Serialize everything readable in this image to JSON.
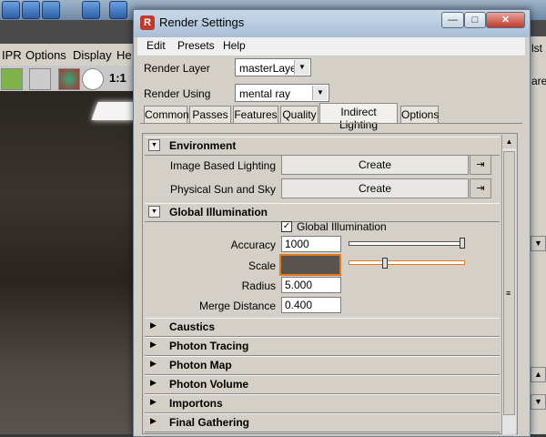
{
  "background_app": {
    "menus": [
      "IPR",
      "Options",
      "Display",
      "He"
    ],
    "toolbar_ratio": "1:1",
    "right_panel_texts": [
      "lst",
      "are"
    ]
  },
  "dialog": {
    "title": "Render Settings",
    "app_icon_glyph": "R",
    "window_buttons": {
      "minimize": "—",
      "maximize": "□",
      "close": "✕"
    },
    "menu": [
      "Edit",
      "Presets",
      "Help"
    ],
    "render_layer": {
      "label": "Render Layer",
      "value": "masterLayer"
    },
    "render_using": {
      "label": "Render Using",
      "value": "mental ray"
    },
    "tabs": [
      "Common",
      "Passes",
      "Features",
      "Quality",
      "Indirect Lighting",
      "Options"
    ],
    "active_tab": "Indirect Lighting",
    "environment": {
      "title": "Environment",
      "rows": [
        {
          "label": "Image Based Lighting",
          "button": "Create"
        },
        {
          "label": "Physical Sun and Sky",
          "button": "Create"
        }
      ]
    },
    "global_illumination": {
      "title": "Global Illumination",
      "checkbox_label": "Global Illumination",
      "checked": true,
      "accuracy": {
        "label": "Accuracy",
        "value": "1000",
        "slider_fraction": 1.0
      },
      "scale": {
        "label": "Scale",
        "color": "#5a5450",
        "slider_fraction": 0.3
      },
      "radius": {
        "label": "Radius",
        "value": "5.000"
      },
      "merge_distance": {
        "label": "Merge Distance",
        "value": "0.400"
      }
    },
    "collapsed_sections": [
      "Caustics",
      "Photon Tracing",
      "Photon Map",
      "Photon Volume",
      "Importons",
      "Final Gathering"
    ],
    "colors": {
      "accent_orange": "#e07a1a",
      "titlebar": "#b7cadf"
    }
  }
}
